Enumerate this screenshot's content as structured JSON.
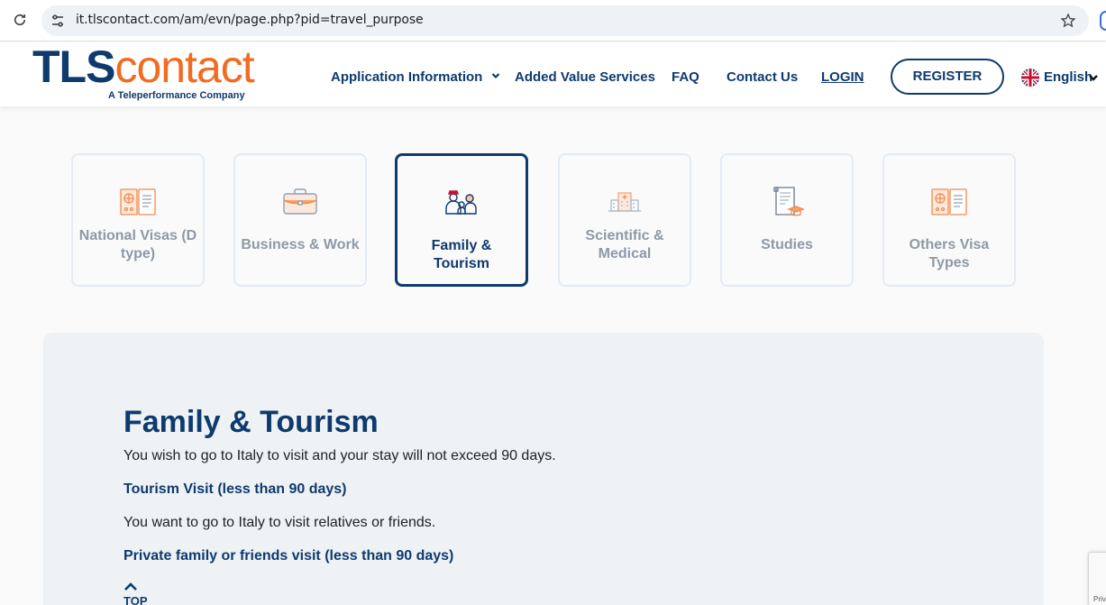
{
  "browser": {
    "url": "it.tlscontact.com/am/evn/page.php?pid=travel_purpose"
  },
  "header": {
    "logo_main_1": "TLS",
    "logo_main_2": "contact",
    "logo_sub": "A Teleperformance Company",
    "nav": {
      "application_info": "Application Information",
      "added_value": "Added Value Services",
      "faq": "FAQ",
      "contact": "Contact Us",
      "login": "LOGIN",
      "register": "REGISTER",
      "language": "English"
    }
  },
  "categories": {
    "national": "National Visas (D type)",
    "business": "Business & Work",
    "family": "Family & Tourism",
    "scientific": "Scientific & Medical",
    "studies": "Studies",
    "others": "Others Visa Types",
    "active": "family"
  },
  "panel": {
    "title": "Family & Tourism",
    "text1": "You wish to go to Italy to visit and your stay will not exceed 90 days.",
    "link1": "Tourism Visit (less than 90 days)",
    "text2": "You want to go to Italy to visit relatives or friends.",
    "link2": "Private family or friends visit (less than 90 days)",
    "top": "TOP"
  },
  "recaptcha": {
    "text": "Priv"
  },
  "colors": {
    "brand_navy": "#0e3a6e",
    "brand_orange": "#f26b21",
    "panel_bg": "#eef2f5",
    "inactive_label": "#8e99a6"
  }
}
